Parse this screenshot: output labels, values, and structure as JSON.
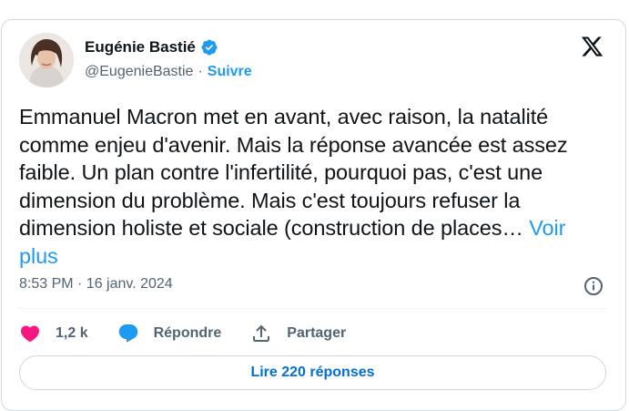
{
  "author": {
    "name": "Eugénie Bastié",
    "handle": "@EugenieBastie",
    "separator": "·",
    "follow_label": "Suivre"
  },
  "tweet": {
    "text": "Emmanuel Macron met en avant, avec raison, la natalité comme enjeu d'avenir. Mais la réponse avancée est assez faible. Un plan contre l'infertilité, pourquoi pas, c'est une dimension du problème. Mais c'est toujours refuser la dimension holiste et sociale (construction de places… ",
    "more_label": "Voir plus",
    "timestamp": "8:53 PM · 16 janv. 2024"
  },
  "actions": {
    "likes": "1,2 k",
    "reply_label": "Répondre",
    "share_label": "Partager"
  },
  "replies_button": "Lire 220 réponses",
  "icons": {
    "verified": "verified-badge-icon",
    "logo": "x-logo-icon",
    "info": "info-icon",
    "like": "heart-icon",
    "reply": "reply-bubble-icon",
    "share": "share-icon"
  },
  "colors": {
    "accent": "#1d9bf0",
    "like": "#f91880",
    "muted": "#536471",
    "text": "#0f1419"
  }
}
